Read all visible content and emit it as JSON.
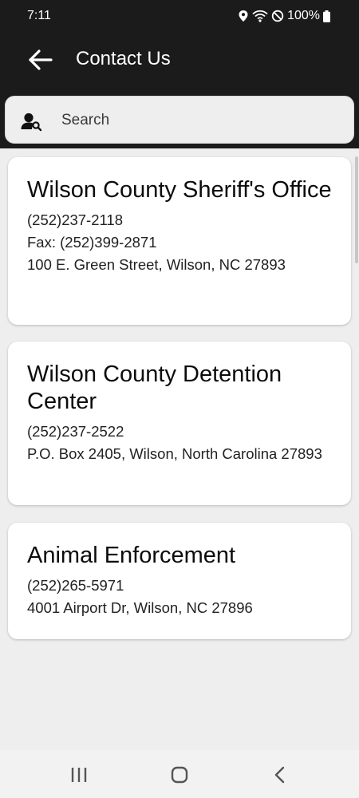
{
  "status_bar": {
    "time": "7:11",
    "battery": "100%",
    "icons": [
      "location-icon",
      "wifi-icon",
      "do-not-disturb-icon",
      "battery-icon"
    ]
  },
  "app_bar": {
    "title": "Contact Us",
    "back_icon": "arrow-left-icon"
  },
  "search": {
    "placeholder": "Search",
    "value": "",
    "icon": "person-search-icon"
  },
  "contacts": [
    {
      "name": "Wilson County Sheriff's Office",
      "lines": [
        "(252)237-2118",
        "Fax: (252)399-2871",
        "100 E. Green Street, Wilson, NC 27893"
      ]
    },
    {
      "name": "Wilson County Detention Center",
      "lines": [
        "(252)237-2522",
        "P.O. Box 2405, Wilson, North Carolina 27893"
      ]
    },
    {
      "name": "Animal Enforcement",
      "lines": [
        "(252)265-5971",
        "4001 Airport Dr, Wilson, NC 27896"
      ]
    }
  ],
  "nav_bar": {
    "icons": [
      "recent-apps-icon",
      "home-icon",
      "back-icon"
    ]
  },
  "colors": {
    "header_bg": "#1c1b1b",
    "page_bg": "#efeeef",
    "card_bg": "#ffffff"
  }
}
